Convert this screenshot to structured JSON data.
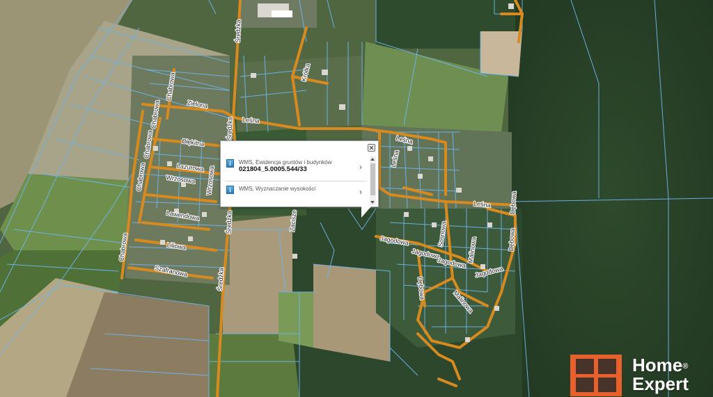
{
  "map": {
    "streets": [
      {
        "id": "chabrowa-1",
        "label": "Chabrowa"
      },
      {
        "id": "chabrowa-2",
        "label": "Chabrowa"
      },
      {
        "id": "chabrowa-3",
        "label": "Chabrowa"
      },
      {
        "id": "chabrowa-4",
        "label": "Chabrowa"
      },
      {
        "id": "chabrowa-5",
        "label": "Chabrowa"
      },
      {
        "id": "zielona",
        "label": "Zielona"
      },
      {
        "id": "sredzka-1",
        "label": "Średzka"
      },
      {
        "id": "sredzka-2",
        "label": "Średzka"
      },
      {
        "id": "sredzka-3",
        "label": "Średzka"
      },
      {
        "id": "sredzka-4",
        "label": "Średzka"
      },
      {
        "id": "lesna-1",
        "label": "Leśna"
      },
      {
        "id": "lesna-2",
        "label": "Leśna"
      },
      {
        "id": "lesna-3",
        "label": "Leśna"
      },
      {
        "id": "lesna-4",
        "label": "Leśna"
      },
      {
        "id": "krotka",
        "label": "Krótka"
      },
      {
        "id": "blekitna",
        "label": "Błękitna"
      },
      {
        "id": "lazurowa",
        "label": "Lazurowa"
      },
      {
        "id": "wrzosowa-1",
        "label": "Wrzosowa"
      },
      {
        "id": "wrzosowa-2",
        "label": "Wrzosowa"
      },
      {
        "id": "lawendowa",
        "label": "Lawendowa"
      },
      {
        "id": "liliowa",
        "label": "Liliowa"
      },
      {
        "id": "szafranowa",
        "label": "Szafranowa"
      },
      {
        "id": "zacisze",
        "label": "Zacisze"
      },
      {
        "id": "jagodowa-1",
        "label": "Jagodowa"
      },
      {
        "id": "jagodowa-2",
        "label": "Jagodowa"
      },
      {
        "id": "jagodowa-3",
        "label": "Jagodowa"
      },
      {
        "id": "jagodowa-4",
        "label": "Jagodowa"
      },
      {
        "id": "sosnowa",
        "label": "Sosnowa"
      },
      {
        "id": "malinowa-1",
        "label": "Malinowa"
      },
      {
        "id": "malinowa-2",
        "label": "Malinowa"
      },
      {
        "id": "debowa-1",
        "label": "Dębowa"
      },
      {
        "id": "debowa-2",
        "label": "Dębowa"
      },
      {
        "id": "debowa-3",
        "label": "Dębowa"
      }
    ]
  },
  "popup": {
    "rows": [
      {
        "title": "WMS, Ewidencja gruntów i budynków",
        "value": "021804_5.0005.544/33"
      },
      {
        "title": "WMS, Wyznaczanie wysokości",
        "value": ""
      }
    ]
  },
  "logo": {
    "line1": "Home",
    "registered": "®",
    "line2": "Expert"
  },
  "colors": {
    "road": "#d68a1f",
    "parcel": "#6fb4ea",
    "accent": "#e8612c"
  }
}
